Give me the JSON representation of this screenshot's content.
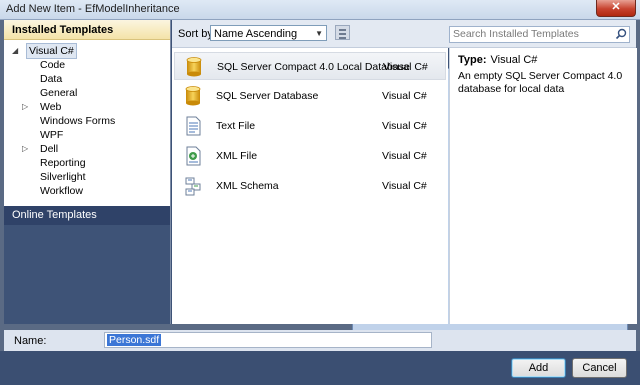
{
  "window": {
    "title": "Add New Item - EfModelInheritance",
    "close_glyph": "✕"
  },
  "left_panel": {
    "installed_header": "Installed Templates",
    "tree": [
      {
        "label": "Visual C#",
        "level": 0,
        "expander": "◢",
        "selected": true
      },
      {
        "label": "Code",
        "level": 1,
        "expander": ""
      },
      {
        "label": "Data",
        "level": 1,
        "expander": ""
      },
      {
        "label": "General",
        "level": 1,
        "expander": ""
      },
      {
        "label": "Web",
        "level": 1,
        "expander": "▷"
      },
      {
        "label": "Windows Forms",
        "level": 1,
        "expander": ""
      },
      {
        "label": "WPF",
        "level": 1,
        "expander": ""
      },
      {
        "label": "Dell",
        "level": 1,
        "expander": "▷"
      },
      {
        "label": "Reporting",
        "level": 1,
        "expander": ""
      },
      {
        "label": "Silverlight",
        "level": 1,
        "expander": ""
      },
      {
        "label": "Workflow",
        "level": 1,
        "expander": ""
      }
    ],
    "online_header": "Online Templates"
  },
  "toolbar": {
    "sort_label": "Sort by:",
    "sort_value": "Name Ascending",
    "search_placeholder": "Search Installed Templates"
  },
  "items": [
    {
      "name": "SQL Server Compact 4.0 Local Database",
      "lang": "Visual C#",
      "icon": "database-icon",
      "selected": true
    },
    {
      "name": "SQL Server Database",
      "lang": "Visual C#",
      "icon": "database-icon",
      "selected": false
    },
    {
      "name": "Text File",
      "lang": "Visual C#",
      "icon": "text-file-icon",
      "selected": false
    },
    {
      "name": "XML File",
      "lang": "Visual C#",
      "icon": "xml-file-icon",
      "selected": false
    },
    {
      "name": "XML Schema",
      "lang": "Visual C#",
      "icon": "xml-schema-icon",
      "selected": false
    }
  ],
  "detail": {
    "type_label": "Type:",
    "type_value": "Visual C#",
    "description": "An empty SQL Server Compact 4.0 database for local data"
  },
  "name_field": {
    "label": "Name:",
    "value": "Person.sdf"
  },
  "buttons": {
    "add": "Add",
    "cancel": "Cancel"
  },
  "colors": {
    "accent": "#3b76d6",
    "header_gold": "#f4e3a8",
    "panel_navy": "#2f4268"
  }
}
